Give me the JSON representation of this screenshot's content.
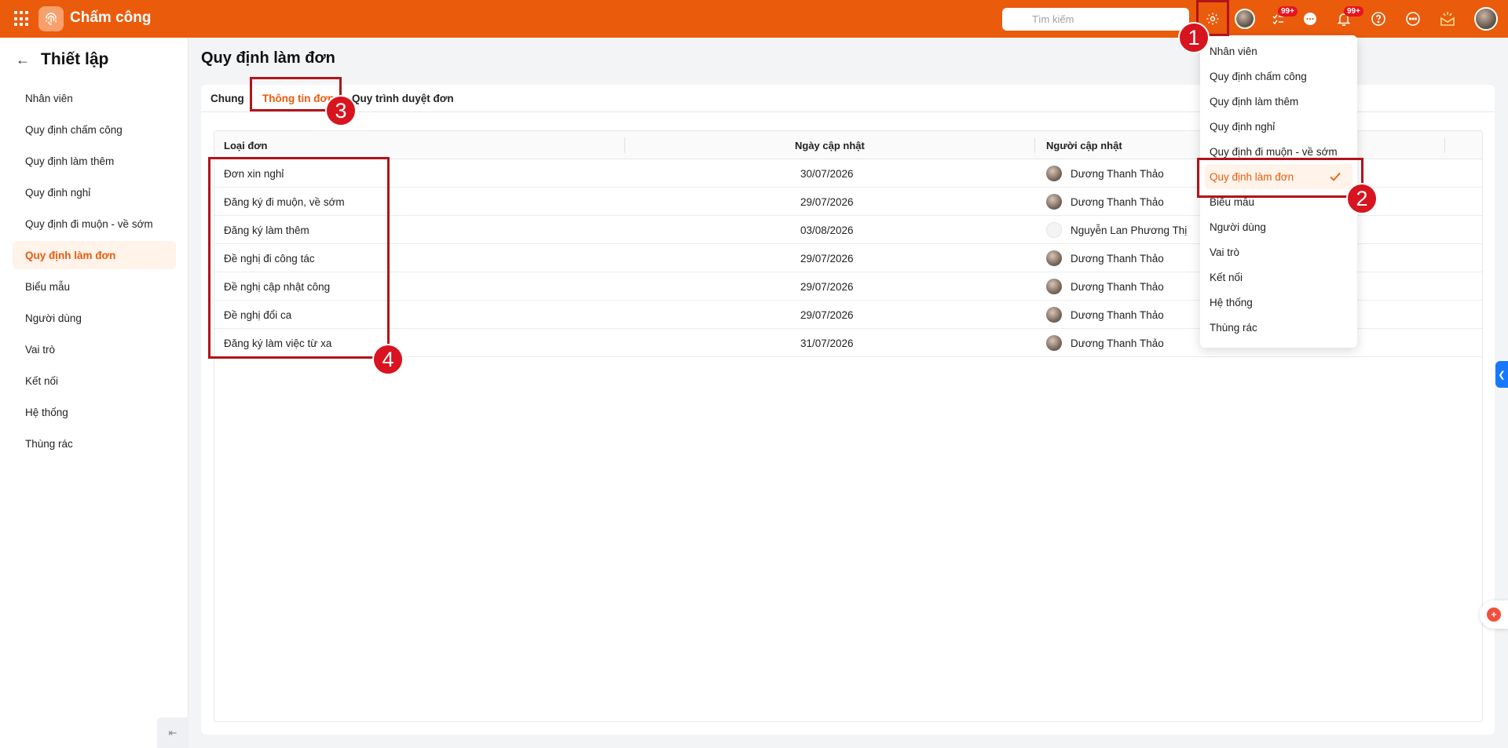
{
  "app": {
    "title": "Chấm công"
  },
  "search": {
    "placeholder": "Tìm kiếm"
  },
  "topbar": {
    "badge_tasks": "99+",
    "badge_notifications": "99+"
  },
  "sidebar": {
    "title": "Thiết lập",
    "items": [
      {
        "label": "Nhân viên"
      },
      {
        "label": "Quy định chấm công"
      },
      {
        "label": "Quy định làm thêm"
      },
      {
        "label": "Quy định nghỉ"
      },
      {
        "label": "Quy định đi muộn - về sớm"
      },
      {
        "label": "Quy định làm đơn",
        "active": true
      },
      {
        "label": "Biểu mẫu"
      },
      {
        "label": "Người dùng"
      },
      {
        "label": "Vai trò"
      },
      {
        "label": "Kết nối"
      },
      {
        "label": "Hệ thống"
      },
      {
        "label": "Thùng rác"
      }
    ]
  },
  "main": {
    "title": "Quy định làm đơn",
    "tabs": [
      {
        "label": "Chung"
      },
      {
        "label": "Thông tin đơn",
        "active": true
      },
      {
        "label": "Quy trình duyệt đơn"
      }
    ],
    "table": {
      "columns": [
        "Loại đơn",
        "Ngày cập nhật",
        "Người cập nhật"
      ],
      "rows": [
        {
          "type": "Đơn xin nghỉ",
          "date": "30/07/2026",
          "user": "Dương Thanh Thảo"
        },
        {
          "type": "Đăng ký đi muộn, về sớm",
          "date": "29/07/2026",
          "user": "Dương Thanh Thảo"
        },
        {
          "type": "Đăng ký làm thêm",
          "date": "03/08/2026",
          "user": "Nguyễn Lan Phương Thị"
        },
        {
          "type": "Đề nghị đi công tác",
          "date": "29/07/2026",
          "user": "Dương Thanh Thảo"
        },
        {
          "type": "Đề nghị cập nhật công",
          "date": "29/07/2026",
          "user": "Dương Thanh Thảo"
        },
        {
          "type": "Đề nghị đổi ca",
          "date": "29/07/2026",
          "user": "Dương Thanh Thảo"
        },
        {
          "type": "Đăng ký làm việc từ xa",
          "date": "31/07/2026",
          "user": "Dương Thanh Thảo"
        }
      ]
    }
  },
  "dropdown": {
    "items": [
      {
        "label": "Nhân viên"
      },
      {
        "label": "Quy định chấm công"
      },
      {
        "label": "Quy định làm thêm"
      },
      {
        "label": "Quy định nghỉ"
      },
      {
        "label": "Quy định đi muộn - về sớm"
      },
      {
        "label": "Quy định làm đơn",
        "active": true
      },
      {
        "label": "Biểu mẫu"
      },
      {
        "label": "Người dùng"
      },
      {
        "label": "Vai trò"
      },
      {
        "label": "Kết nối"
      },
      {
        "label": "Hệ thống"
      },
      {
        "label": "Thùng rác"
      }
    ]
  },
  "annotations": [
    "1",
    "2",
    "3",
    "4"
  ],
  "colors": {
    "brand": "#ea5b0c",
    "annotation": "#b1141b"
  }
}
